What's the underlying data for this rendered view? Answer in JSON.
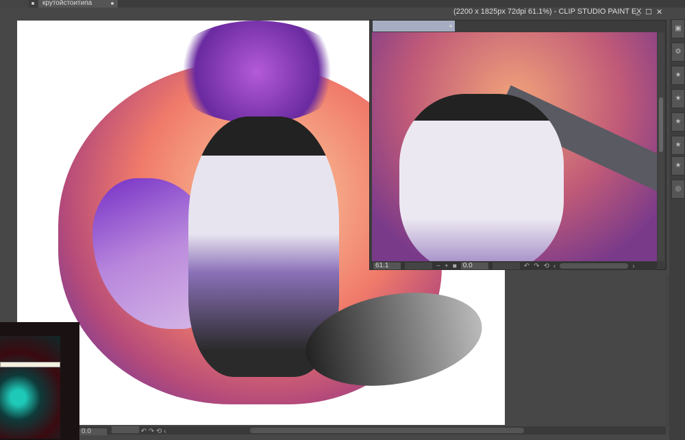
{
  "tabs": [
    {
      "label": ""
    },
    {
      "label": "крутойстоитипа"
    }
  ],
  "window": {
    "title": "(2200 x 1825px 72dpi 61.1%)  - CLIP STUDIO PAINT EX",
    "minimize": "_",
    "maximize": "☐",
    "close": "✕"
  },
  "navigator": {
    "zoom": "61.1",
    "rotation": "0.0",
    "zoom_out": "−",
    "zoom_in": "+",
    "fit": "■",
    "rotate_left": "↶",
    "rotate_right": "↷",
    "reset": "⟲",
    "prev": "‹",
    "next": "›"
  },
  "main_nav": {
    "rotation": "0.0",
    "rotate_left": "↶",
    "rotate_right": "↷",
    "reset": "⟲",
    "prev": "‹"
  },
  "panel_icons": [
    "layer-icon",
    "gear-icon",
    "folder-icon",
    "folder-icon",
    "folder-icon",
    "folder-icon",
    "folder-icon",
    "camera-icon"
  ],
  "colors": {
    "ui_bg": "#474747",
    "tab_active": "#a6adc2"
  }
}
